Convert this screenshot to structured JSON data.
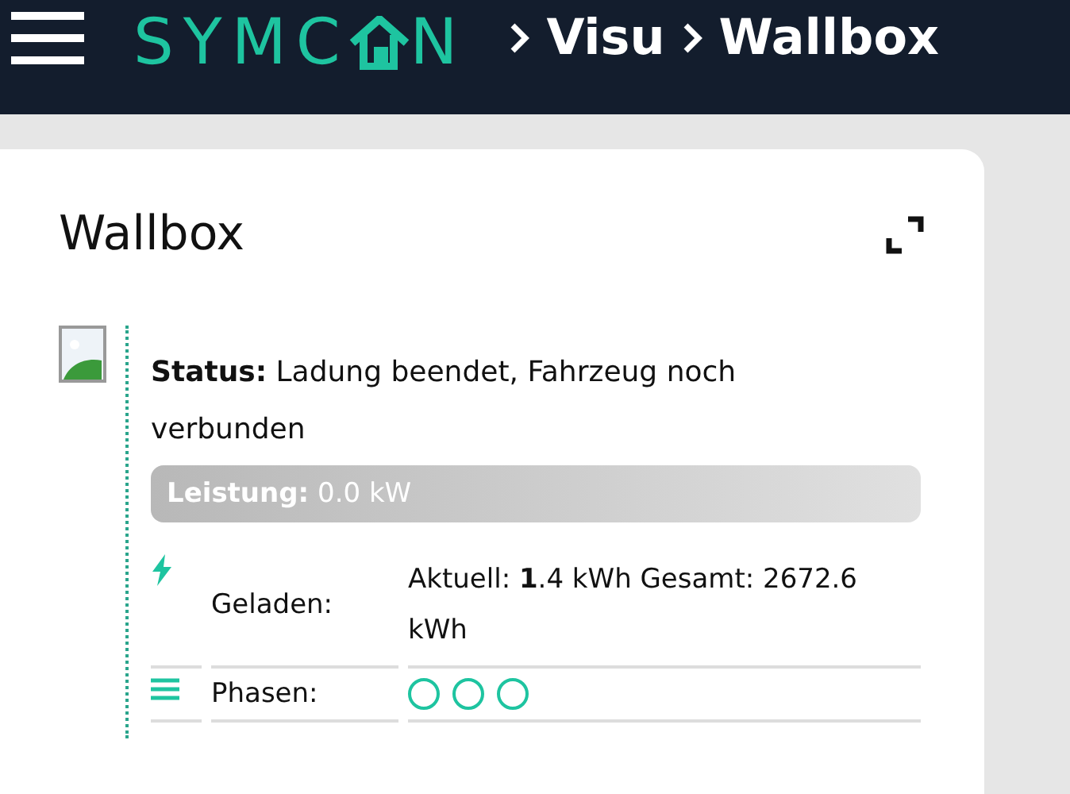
{
  "header": {
    "logo_parts": [
      "SYMC",
      "N"
    ],
    "breadcrumb": [
      "Visu",
      "Wallbox"
    ]
  },
  "card": {
    "title": "Wallbox",
    "status": "**Status:** Ladung beendet, Fahrzeug noch verbunden",
    "power": {
      "text": "**Leistung:** 0.0 kW",
      "level": 0
    },
    "rows": [
      {
        "kind": "energy",
        "label": "Geladen:",
        "value": "Aktuell: **1**.4 kWh Gesamt: 2672.6 kWh"
      },
      {
        "kind": "phases",
        "label": "Phasen:",
        "phases": [
          {
            "on": false
          },
          {
            "on": false
          },
          {
            "on": false
          }
        ]
      }
    ]
  }
}
